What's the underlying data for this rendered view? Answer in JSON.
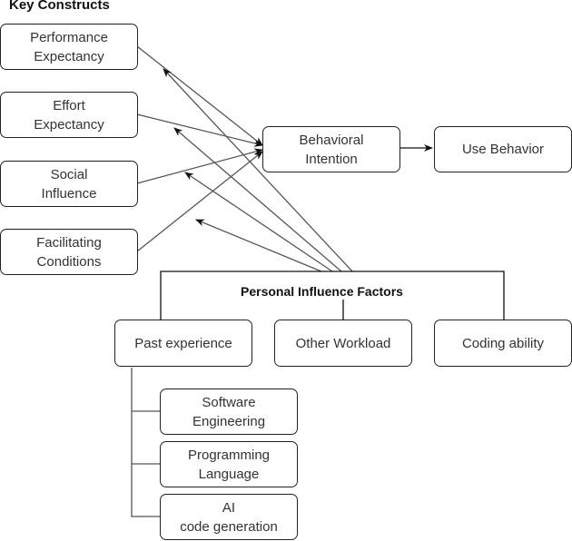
{
  "title": "Key Constructs",
  "key_constructs": [
    {
      "id": "pe",
      "label": "Performance\nExpectancy"
    },
    {
      "id": "ee",
      "label": "Effort\nExpectancy"
    },
    {
      "id": "si",
      "label": "Social\nInfluence"
    },
    {
      "id": "fc",
      "label": "Facilitating\nConditions"
    }
  ],
  "behavioral_intention": "Behavioral\nIntention",
  "use_behavior": "Use Behavior",
  "personal_factors": {
    "label": "Personal Influence Factors",
    "items": [
      {
        "id": "past",
        "label": "Past experience"
      },
      {
        "id": "workload",
        "label": "Other Workload"
      },
      {
        "id": "coding",
        "label": "Coding ability"
      }
    ],
    "past_experience_subitems": [
      {
        "label": "Software\nEngineering"
      },
      {
        "label": "Programming\nLanguage"
      },
      {
        "label": "AI\ncode generation"
      }
    ]
  },
  "edges": [
    {
      "from": "Performance Expectancy",
      "to": "Behavioral Intention"
    },
    {
      "from": "Effort Expectancy",
      "to": "Behavioral Intention"
    },
    {
      "from": "Social Influence",
      "to": "Behavioral Intention"
    },
    {
      "from": "Facilitating Conditions",
      "to": "Behavioral Intention"
    },
    {
      "from": "Behavioral Intention",
      "to": "Use Behavior"
    },
    {
      "from": "Personal Influence Factors",
      "to": "Performance Expectancy link (moderator)"
    },
    {
      "from": "Personal Influence Factors",
      "to": "Effort Expectancy link (moderator)"
    },
    {
      "from": "Personal Influence Factors",
      "to": "Social Influence link (moderator)"
    },
    {
      "from": "Personal Influence Factors",
      "to": "Facilitating Conditions link (moderator)"
    }
  ]
}
